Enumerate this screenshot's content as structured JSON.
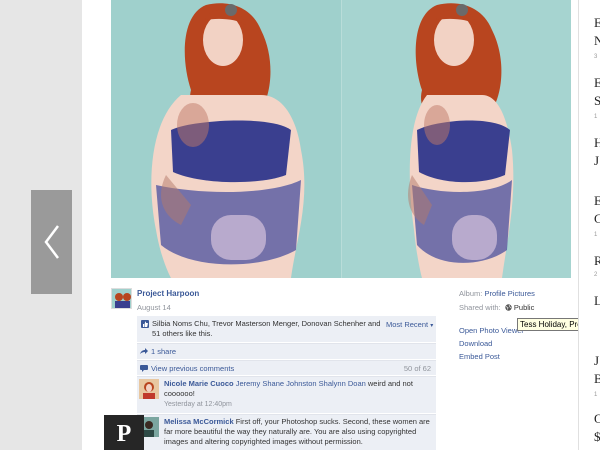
{
  "nav": {
    "prev_label": "‹"
  },
  "image": {
    "alt": ""
  },
  "post": {
    "poster": "Project Harpoon",
    "date": "August 14",
    "likes": "Silbia Noms Chu, Trevor Masterson Menger, Donovan Schenher and 51 others like this.",
    "most_recent": "Most Recent",
    "share": "1 share",
    "view_previous": "View previous comments",
    "count": "50 of 62",
    "comments": [
      {
        "name": "Nicole Marie Cuoco",
        "tags": "Jeremy Shane Johnston Shalynn Doan",
        "text": " weird and not coooooo!",
        "time": "Yesterday at 12:40pm"
      },
      {
        "name": "Melissa McCormick",
        "tags": "",
        "text": " First off, your Photoshop sucks. Second, these women are far more beautiful the way they naturally are. You are also using copyrighted images and altering copyrighted images without permission.",
        "time": ""
      }
    ]
  },
  "side": {
    "album_label": "Album:",
    "album_value": "Profile Pictures",
    "shared_label": "Shared with:",
    "shared_value": "Public",
    "open_photo": "Open Photo Viewer",
    "download": "Download",
    "embed": "Embed Post",
    "tooltip": "Tess Holiday, Project"
  },
  "rail": {
    "items": [
      {
        "text": "E"
      },
      {
        "text": "N"
      },
      {
        "text": "E"
      },
      {
        "text": "S"
      },
      {
        "text": "H"
      },
      {
        "text": "J"
      },
      {
        "text": "E"
      },
      {
        "text": "C"
      },
      {
        "text": "R"
      },
      {
        "text": "L"
      },
      {
        "text": "J"
      },
      {
        "text": "B"
      },
      {
        "text": "O"
      },
      {
        "text": "$"
      }
    ],
    "small": [
      "3",
      "1",
      "1",
      "2",
      "1"
    ]
  },
  "colors": {
    "fb_blue": "#3b5998",
    "photo_bg": "#9fd0cc",
    "hair": "#b8451f",
    "lingerie": "#3a3f8f"
  }
}
